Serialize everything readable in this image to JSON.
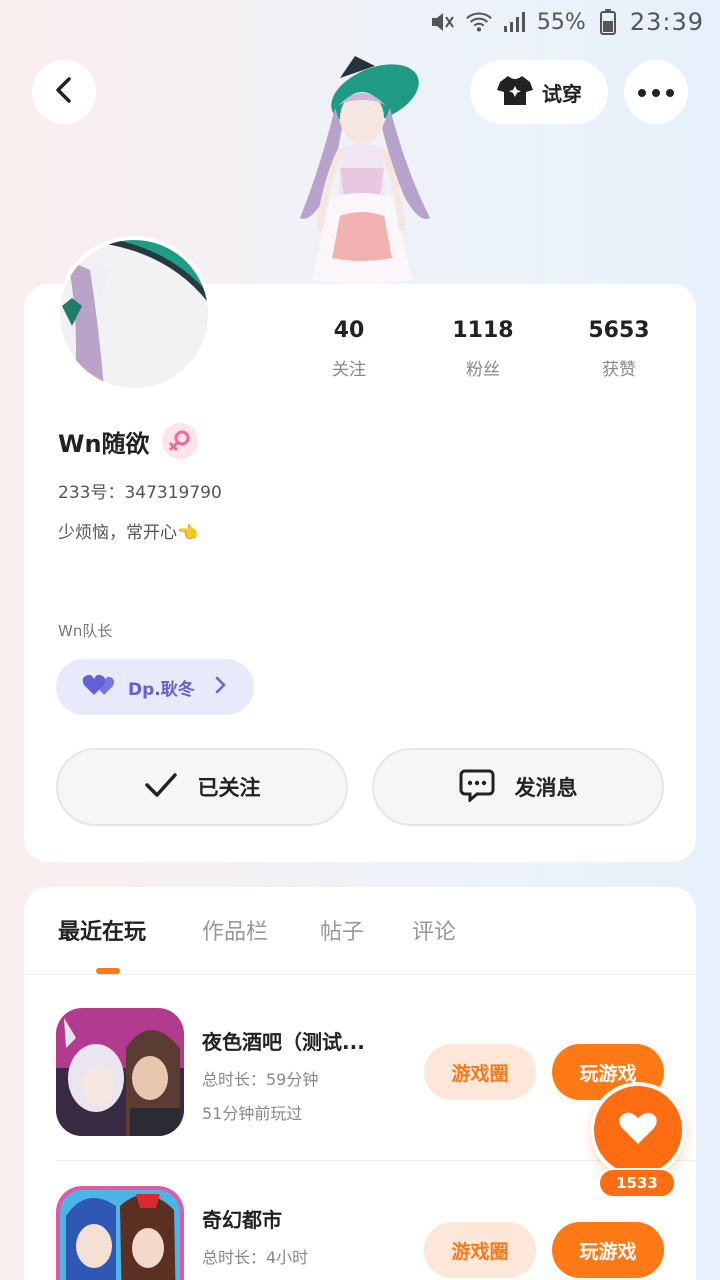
{
  "status_bar": {
    "battery_percent": "55%",
    "time": "23:39",
    "icons": [
      "mute-icon",
      "wifi-icon",
      "signal-icon",
      "battery-icon"
    ]
  },
  "header": {
    "try_on_label": "试穿"
  },
  "profile": {
    "stats": [
      {
        "value": "40",
        "label": "关注"
      },
      {
        "value": "1118",
        "label": "粉丝"
      },
      {
        "value": "5653",
        "label": "获赞"
      }
    ],
    "username": "Wn随欲",
    "gender": "female",
    "uid_text": "233号：347319790",
    "bio": "少烦恼，常开心👈",
    "team_label": "Wn队长",
    "team_name": "Dp.耿冬",
    "followed_label": "已关注",
    "message_label": "发消息"
  },
  "tabs": [
    "最近在玩",
    "作品栏",
    "帖子",
    "评论"
  ],
  "active_tab": 0,
  "games": [
    {
      "title": "夜色酒吧（测试...",
      "total_time": "总时长：59分钟",
      "last_played": "51分钟前玩过",
      "circle_label": "游戏圈",
      "play_label": "玩游戏"
    },
    {
      "title": "奇幻都市",
      "total_time": "总时长：4小时",
      "circle_label": "游戏圈",
      "play_label": "玩游戏"
    }
  ],
  "like_count": "1533",
  "colors": {
    "accent": "#ff7a16",
    "team_chip_bg": "#e9e9fc",
    "team_chip_text": "#6162d8"
  }
}
